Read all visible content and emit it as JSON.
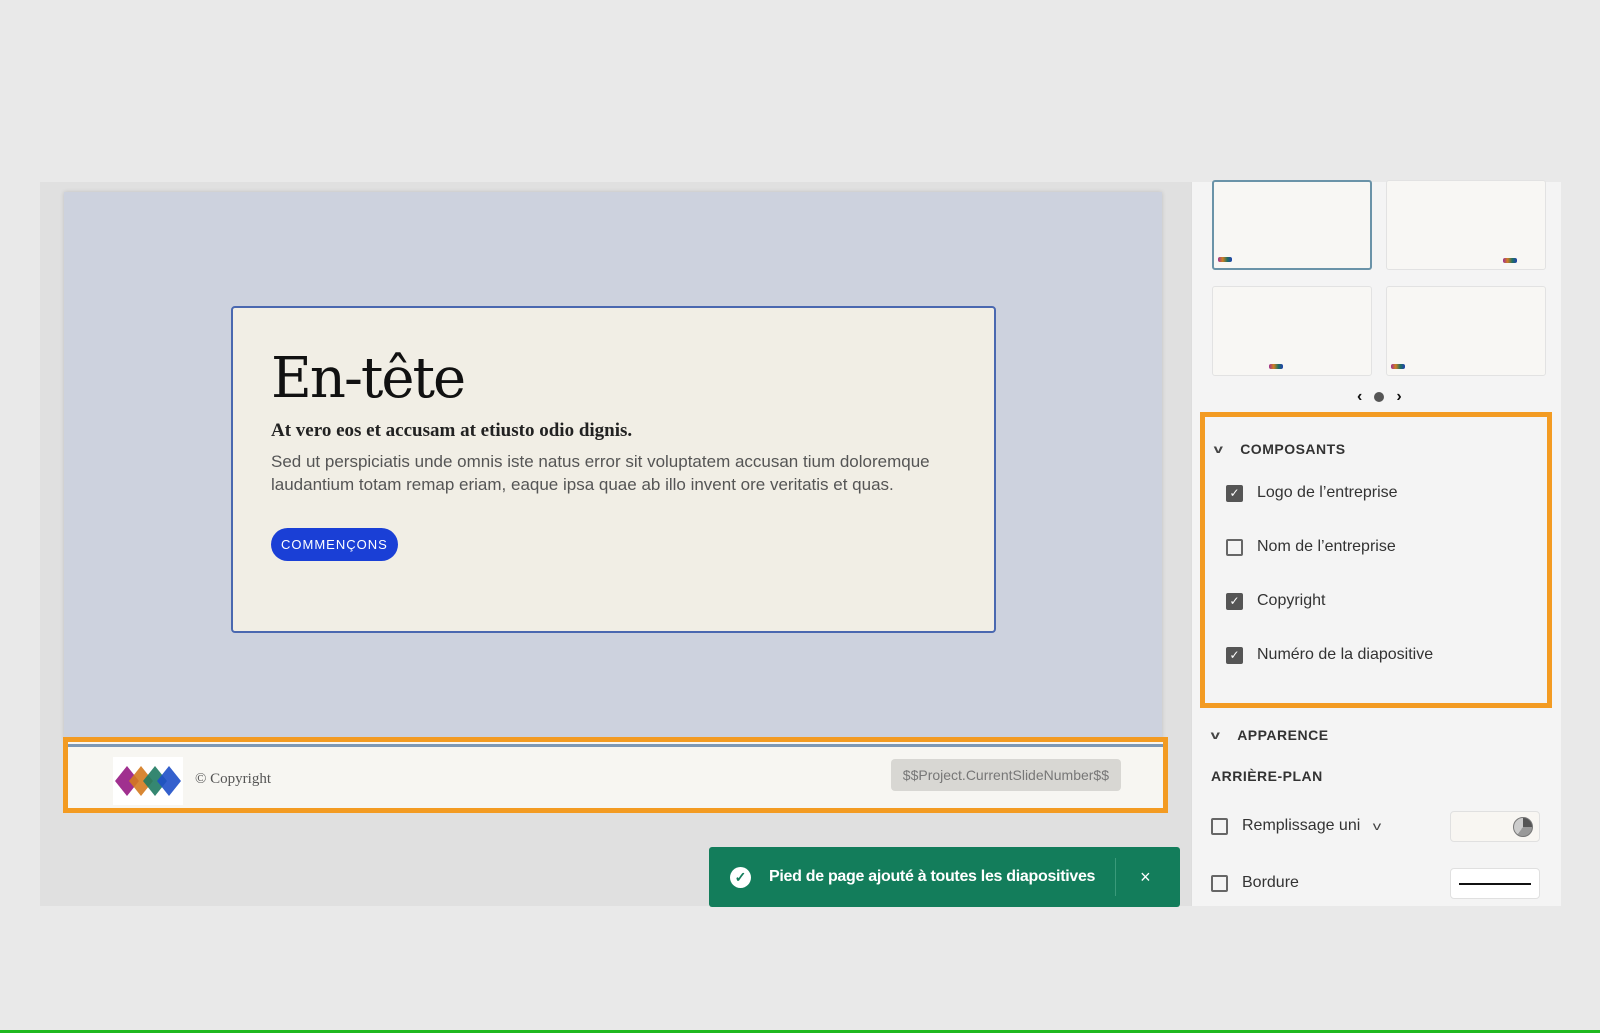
{
  "slide": {
    "title": "En-tête",
    "subtitle": "At vero eos et accusam at etiusto odio dignis.",
    "body": "Sed ut perspiciatis unde omnis iste natus error sit voluptatem accusan tium doloremque laudantium totam remap eriam, eaque ipsa quae ab illo invent ore veritatis et quas.",
    "button": "COMMENÇONS"
  },
  "footer": {
    "copyright": "© Copyright",
    "slide_number": "$$Project.CurrentSlideNumber$$"
  },
  "panel": {
    "components": {
      "title": "COMPOSANTS",
      "items": [
        {
          "label": "Logo de l’entreprise",
          "checked": true
        },
        {
          "label": "Nom de l’entreprise",
          "checked": false
        },
        {
          "label": "Copyright",
          "checked": true
        },
        {
          "label": "Numéro de la diapositive",
          "checked": true
        }
      ]
    },
    "appearance": {
      "title": "APPARENCE",
      "background_label": "ARRIÈRE-PLAN",
      "fill_label": "Remplissage uni",
      "border_label": "Bordure"
    }
  },
  "toast": {
    "message": "Pied de page ajouté à toutes les diapositives",
    "close": "×"
  },
  "colors": {
    "accent": "#f39b22",
    "toast": "#137d5b",
    "button": "#1a3fd6"
  }
}
